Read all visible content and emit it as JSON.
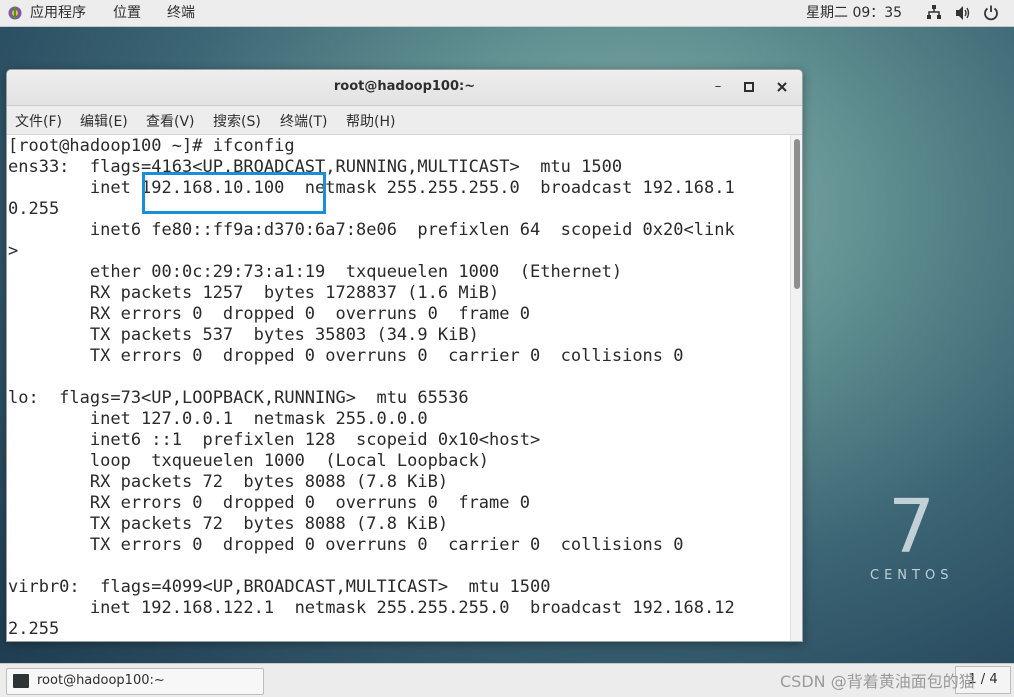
{
  "topbar": {
    "applications": "应用程序",
    "places": "位置",
    "terminal": "终端",
    "clock": "星期二 09：35"
  },
  "desktop": {
    "logo_number": "7",
    "logo_word": "CENTOS"
  },
  "window": {
    "title": "root@hadoop100:~",
    "menu": [
      "文件(F)",
      "编辑(E)",
      "查看(V)",
      "搜索(S)",
      "终端(T)",
      "帮助(H)"
    ]
  },
  "terminal": {
    "lines": [
      "[root@hadoop100 ~]# ifconfig",
      "ens33:  flags=4163<UP,BROADCAST,RUNNING,MULTICAST>  mtu 1500",
      "        inet 192.168.10.100  netmask 255.255.255.0  broadcast 192.168.1",
      "0.255",
      "        inet6 fe80::ff9a:d370:6a7:8e06  prefixlen 64  scopeid 0x20<link",
      ">",
      "        ether 00:0c:29:73:a1:19  txqueuelen 1000  (Ethernet)",
      "        RX packets 1257  bytes 1728837 (1.6 MiB)",
      "        RX errors 0  dropped 0  overruns 0  frame 0",
      "        TX packets 537  bytes 35803 (34.9 KiB)",
      "        TX errors 0  dropped 0 overruns 0  carrier 0  collisions 0",
      "",
      "lo:  flags=73<UP,LOOPBACK,RUNNING>  mtu 65536",
      "        inet 127.0.0.1  netmask 255.0.0.0",
      "        inet6 ::1  prefixlen 128  scopeid 0x10<host>",
      "        loop  txqueuelen 1000  (Local Loopback)",
      "        RX packets 72  bytes 8088 (7.8 KiB)",
      "        RX errors 0  dropped 0  overruns 0  frame 0",
      "        TX packets 72  bytes 8088 (7.8 KiB)",
      "        TX errors 0  dropped 0 overruns 0  carrier 0  collisions 0",
      "",
      "virbr0:  flags=4099<UP,BROADCAST,MULTICAST>  mtu 1500",
      "        inet 192.168.122.1  netmask 255.255.255.0  broadcast 192.168.12",
      "2.255"
    ]
  },
  "taskbar": {
    "window_label": "root@hadoop100:~",
    "pager": "1 / 4"
  },
  "watermark": "CSDN @背着黄油面包的猫",
  "colors": {
    "highlight": "#1a8fd6"
  }
}
